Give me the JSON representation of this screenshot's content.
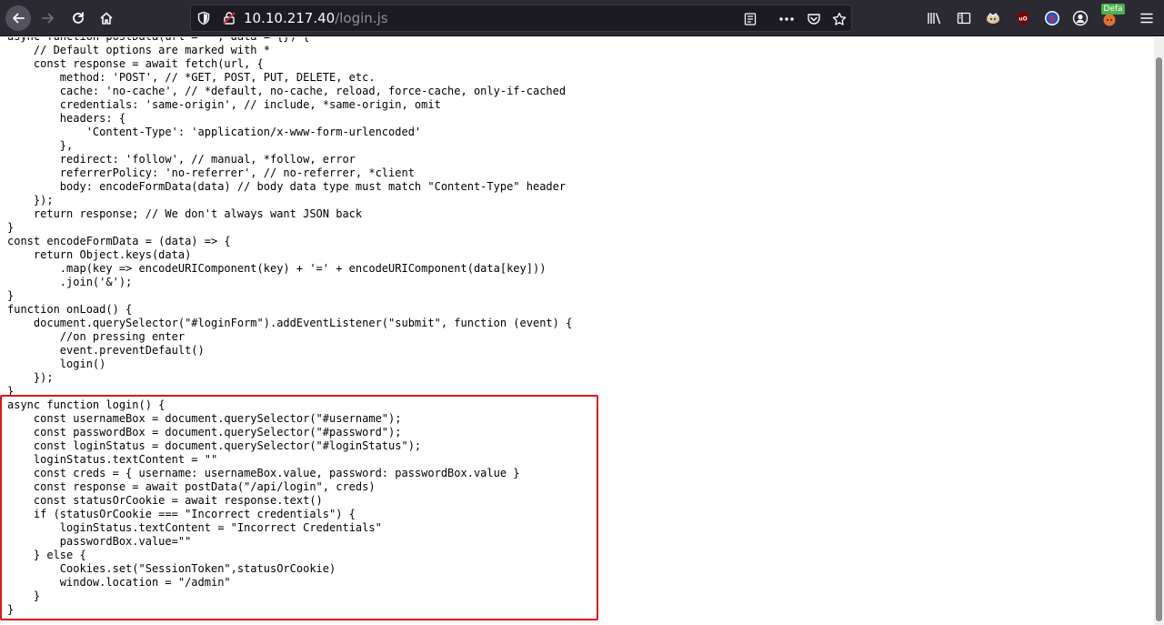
{
  "browser": {
    "url_host": "10.10.217.40",
    "url_path": "/login.js",
    "badge_text": "Defa",
    "icons": {
      "back": "back-arrow-icon",
      "forward": "forward-arrow-icon",
      "reload": "reload-icon",
      "home": "home-icon",
      "tracking": "shield-icon",
      "insecure": "insecure-lock-icon",
      "reader": "reader-view-icon",
      "page_actions": "more-icon",
      "pocket": "pocket-icon",
      "bookmark": "star-icon",
      "library": "library-icon",
      "sidebar": "sidebar-icon",
      "extension1": "extension-icon",
      "ublock": "ublock-icon",
      "extension2": "extension-s-icon",
      "account": "account-icon",
      "foxyproxy": "foxyproxy-icon",
      "menu": "hamburger-menu-icon"
    },
    "colors": {
      "toolbar": "#2b2a33",
      "urlbar": "#1c1b22",
      "highlight": "#e0141e",
      "badge": "#4caf50"
    }
  },
  "code_lines": [
    "async function postData(url = '', data = {}) {",
    "    // Default options are marked with *",
    "    const response = await fetch(url, {",
    "        method: 'POST', // *GET, POST, PUT, DELETE, etc.",
    "        cache: 'no-cache', // *default, no-cache, reload, force-cache, only-if-cached",
    "        credentials: 'same-origin', // include, *same-origin, omit",
    "        headers: {",
    "            'Content-Type': 'application/x-www-form-urlencoded'",
    "        },",
    "        redirect: 'follow', // manual, *follow, error",
    "        referrerPolicy: 'no-referrer', // no-referrer, *client",
    "        body: encodeFormData(data) // body data type must match \"Content-Type\" header",
    "    });",
    "    return response; // We don't always want JSON back",
    "}",
    "const encodeFormData = (data) => {",
    "    return Object.keys(data)",
    "        .map(key => encodeURIComponent(key) + '=' + encodeURIComponent(data[key]))",
    "        .join('&');",
    "}",
    "function onLoad() {",
    "    document.querySelector(\"#loginForm\").addEventListener(\"submit\", function (event) {",
    "        //on pressing enter",
    "        event.preventDefault()",
    "        login()",
    "    });",
    "}",
    "async function login() {",
    "    const usernameBox = document.querySelector(\"#username\");",
    "    const passwordBox = document.querySelector(\"#password\");",
    "    const loginStatus = document.querySelector(\"#loginStatus\");",
    "    loginStatus.textContent = \"\"",
    "    const creds = { username: usernameBox.value, password: passwordBox.value }",
    "    const response = await postData(\"/api/login\", creds)",
    "    const statusOrCookie = await response.text()",
    "    if (statusOrCookie === \"Incorrect credentials\") {",
    "        loginStatus.textContent = \"Incorrect Credentials\"",
    "        passwordBox.value=\"\"",
    "    } else {",
    "        Cookies.set(\"SessionToken\",statusOrCookie)",
    "        window.location = \"/admin\"",
    "    }",
    "}"
  ]
}
